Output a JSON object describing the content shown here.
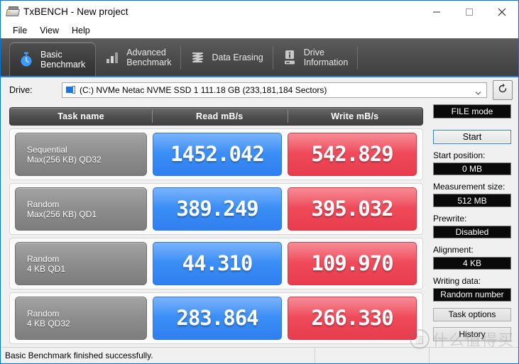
{
  "window": {
    "title": "TxBENCH - New project",
    "app_icon": "drive-icon",
    "controls": {
      "minimize": "minimize-icon",
      "maximize": "maximize-icon",
      "close": "close-icon"
    }
  },
  "menu": {
    "items": [
      {
        "label": "File"
      },
      {
        "label": "View"
      },
      {
        "label": "Help"
      }
    ]
  },
  "tabs": [
    {
      "label": "Basic\nBenchmark",
      "icon": "stopwatch-icon",
      "active": true
    },
    {
      "label": "Advanced\nBenchmark",
      "icon": "bar-chart-icon",
      "active": false
    },
    {
      "label": "Data Erasing",
      "icon": "shred-icon",
      "active": false
    },
    {
      "label": "Drive\nInformation",
      "icon": "drive-info-icon",
      "active": false
    }
  ],
  "drive": {
    "label": "Drive:",
    "selected": "(C:) NVMe Netac NVME SSD 1  111.18 GB (233,181,184 Sectors)",
    "dropdown_icon": "chevron-down-icon",
    "refresh_icon": "refresh-icon"
  },
  "results": {
    "columns": [
      "Task name",
      "Read mB/s",
      "Write mB/s"
    ],
    "rows": [
      {
        "name_line1": "Sequential",
        "name_line2": "Max(256 KB) QD32",
        "read": "1452.042",
        "write": "542.829"
      },
      {
        "name_line1": "Random",
        "name_line2": "Max(256 KB) QD1",
        "read": "389.249",
        "write": "395.032"
      },
      {
        "name_line1": "Random",
        "name_line2": "4 KB QD1",
        "read": "44.310",
        "write": "109.970"
      },
      {
        "name_line1": "Random",
        "name_line2": "4 KB QD32",
        "read": "283.864",
        "write": "266.330"
      }
    ]
  },
  "colors": {
    "read": "#3a8ef5",
    "write": "#ef4a5a",
    "accent": "#2f7fd6"
  },
  "panel": {
    "mode_button": "FILE mode",
    "start_button": "Start",
    "fields": [
      {
        "label": "Start position:",
        "value": "0 MB"
      },
      {
        "label": "Measurement size:",
        "value": "512 MB"
      },
      {
        "label": "Prewrite:",
        "value": "Disabled"
      },
      {
        "label": "Alignment:",
        "value": "4 KB"
      },
      {
        "label": "Writing data:",
        "value": "Random number"
      }
    ],
    "task_options_button": "Task options",
    "history_button": "History"
  },
  "status": {
    "message": "Basic Benchmark finished successfully."
  },
  "watermark": {
    "mark": "值",
    "text": "什么值得买"
  }
}
